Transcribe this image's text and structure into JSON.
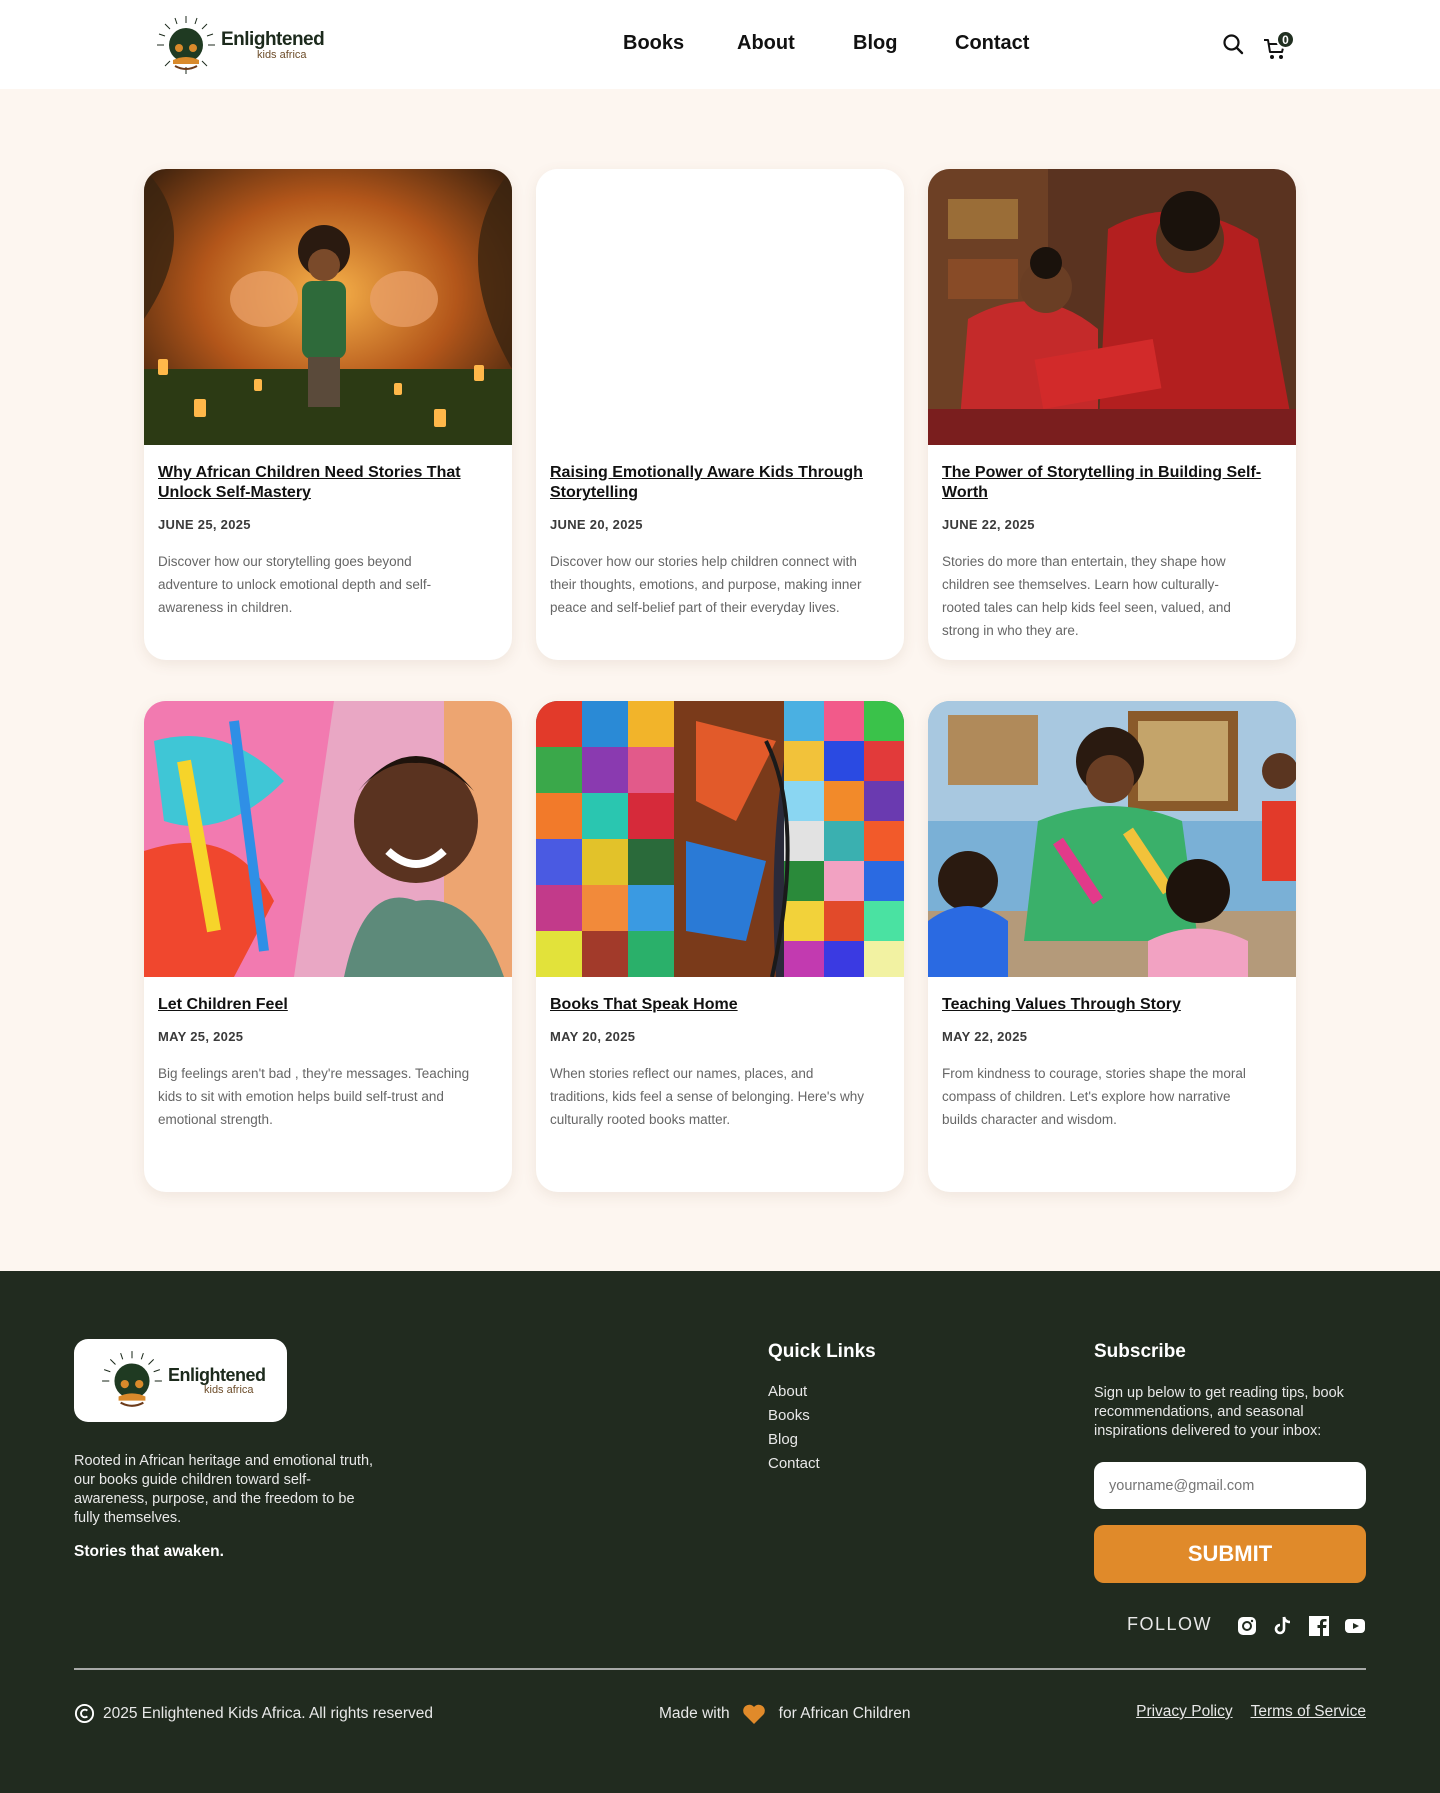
{
  "brand": {
    "name_line1": "Enlightened",
    "name_line2": "kids africa",
    "colors": {
      "dark_green": "#212b1f",
      "accent_orange": "#e08a2a",
      "page_bg": "#fdf6f0"
    }
  },
  "header": {
    "nav": [
      "Books",
      "About",
      "Blog",
      "Contact"
    ],
    "search_icon": "search-icon",
    "cart_icon": "cart-icon",
    "cart_count": "0"
  },
  "posts": [
    {
      "title": "Why African Children Need Stories That Unlock Self-Mastery",
      "date": "JUNE 25, 2025",
      "excerpt": "Discover how our storytelling goes beyond adventure to unlock emotional depth and self-awareness in children.",
      "image": "boy-in-lantern-forest-with-elephants"
    },
    {
      "title": "Raising Emotionally Aware Kids Through Storytelling",
      "date": "JUNE 20, 2025",
      "excerpt": "Discover how our stories help children connect with their thoughts, emotions, and purpose, making inner peace and self-belief part of their everyday lives.",
      "image": ""
    },
    {
      "title": "The Power of Storytelling in Building Self-Worth",
      "date": "JUNE 22, 2025",
      "excerpt": "Stories do more than entertain, they shape how children see themselves. Learn how culturally-rooted tales can help kids feel seen, valued, and strong in who they are.",
      "image": "mother-and-daughter-reading"
    },
    {
      "title": "Let Children Feel",
      "date": "MAY 25, 2025",
      "excerpt": "Big feelings aren't bad , they're messages. Teaching kids to sit with emotion helps build self-trust and emotional strength.",
      "image": "girl-painting-mural"
    },
    {
      "title": "Books That Speak Home",
      "date": "MAY 20, 2025",
      "excerpt": "When stories reflect our names, places, and traditions, kids feel a sense of belonging. Here's why culturally rooted books matter.",
      "image": "patchwork-fabric-portrait"
    },
    {
      "title": "Teaching Values Through Story",
      "date": "MAY 22, 2025",
      "excerpt": "From kindness to courage, stories shape the moral compass of children. Let's explore how narrative builds character and wisdom.",
      "image": "teacher-with-children"
    }
  ],
  "footer": {
    "about": "Rooted in African heritage and emotional truth, our books guide children toward self-awareness, purpose, and the freedom to be fully themselves.",
    "tagline": "Stories that awaken.",
    "quick_links_heading": "Quick Links",
    "quick_links": [
      "About",
      "Books",
      "Blog",
      "Contact"
    ],
    "subscribe_heading": "Subscribe",
    "subscribe_text": "Sign up below to get reading tips, book recommendations, and seasonal inspirations delivered to your inbox:",
    "email_placeholder": "yourname@gmail.com",
    "submit_label": "SUBMIT",
    "follow_label": "FOLLOW",
    "social_icons": [
      "instagram-icon",
      "tiktok-icon",
      "facebook-icon",
      "youtube-icon"
    ],
    "copyright": "2025 Enlightened Kids Africa. All rights reserved",
    "made_with_prefix": "Made with",
    "made_with_suffix": "for African Children",
    "privacy": "Privacy Policy",
    "terms": "Terms of Service"
  }
}
